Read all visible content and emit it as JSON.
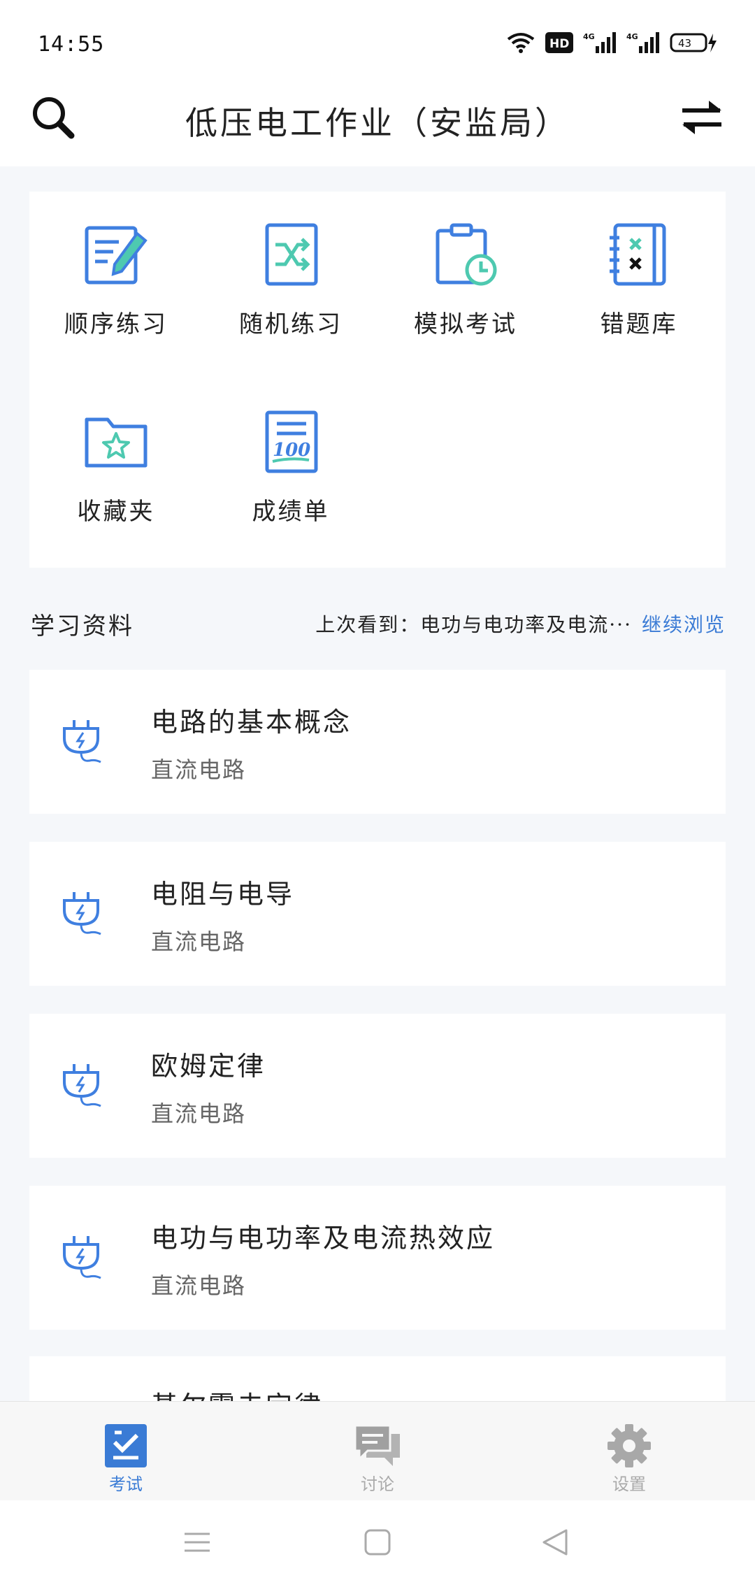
{
  "status": {
    "time": "14:55",
    "battery": "43",
    "network": "4G"
  },
  "appbar": {
    "title": "低压电工作业（安监局）"
  },
  "features": [
    {
      "label": "顺序练习",
      "icon": "sequential-practice-icon"
    },
    {
      "label": "随机练习",
      "icon": "random-practice-icon"
    },
    {
      "label": "模拟考试",
      "icon": "mock-exam-icon"
    },
    {
      "label": "错题库",
      "icon": "wrong-questions-icon"
    },
    {
      "label": "收藏夹",
      "icon": "favorites-icon"
    },
    {
      "label": "成绩单",
      "icon": "score-sheet-icon"
    }
  ],
  "study": {
    "title": "学习资料",
    "last_view_prefix": "上次看到：",
    "last_view_item": "电功与电功率及电流···",
    "continue_label": "继续浏览"
  },
  "materials": [
    {
      "title": "电路的基本概念",
      "category": "直流电路"
    },
    {
      "title": "电阻与电导",
      "category": "直流电路"
    },
    {
      "title": "欧姆定律",
      "category": "直流电路"
    },
    {
      "title": "电功与电功率及电流热效应",
      "category": "直流电路"
    },
    {
      "title": "基尔霍夫定律",
      "category": ""
    }
  ],
  "nav": [
    {
      "label": "考试",
      "active": true
    },
    {
      "label": "讨论",
      "active": false
    },
    {
      "label": "设置",
      "active": false
    }
  ],
  "colors": {
    "accent": "#3a7bd5",
    "icon_blue": "#3f7fe0",
    "icon_green": "#4ec9b0"
  }
}
